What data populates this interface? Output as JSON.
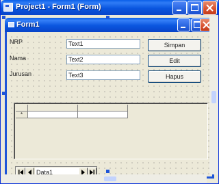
{
  "ide_window": {
    "title": "Project1 - Form1 (Form)"
  },
  "form": {
    "title": "Form1",
    "fields": [
      {
        "label": "NRP",
        "value": "Text1"
      },
      {
        "label": "Nama",
        "value": "Text2"
      },
      {
        "label": "Jurusan",
        "value": "Text3"
      }
    ],
    "buttons": {
      "simpan": "Simpan",
      "edit": "Edit",
      "hapus": "Hapus"
    },
    "grid": {
      "new_row_marker": "*"
    },
    "data_control": {
      "caption": "Data1"
    }
  },
  "colors": {
    "titlebar": "#0a56df",
    "close_button": "#d8502e",
    "form_bg": "#ece9d8"
  },
  "icons": {
    "ide_window": [
      "app-icon",
      "minimize-icon",
      "maximize-icon",
      "close-icon"
    ],
    "form": [
      "form-icon",
      "minimize-icon",
      "maximize-icon",
      "close-icon"
    ],
    "data_control": [
      "first-record-icon",
      "previous-record-icon",
      "next-record-icon",
      "last-record-icon"
    ]
  }
}
